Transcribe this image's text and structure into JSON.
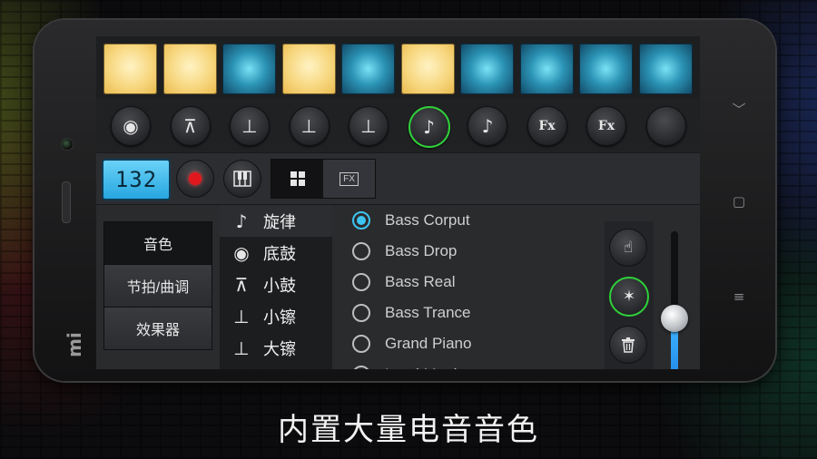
{
  "pads": [
    "on",
    "on",
    "off",
    "on",
    "off",
    "on",
    "off",
    "off",
    "off",
    "off"
  ],
  "instrument_buttons": [
    {
      "icon": "kick-drum-icon",
      "glyph": "◉",
      "active": false
    },
    {
      "icon": "snare-drum-icon",
      "glyph": "⊼",
      "active": false
    },
    {
      "icon": "hihat-icon",
      "glyph": "⊥",
      "active": false
    },
    {
      "icon": "crash-cymbal-icon",
      "glyph": "⊥",
      "active": false
    },
    {
      "icon": "ride-cymbal-icon",
      "glyph": "⊥",
      "active": false
    },
    {
      "icon": "music-note-icon",
      "glyph": "♪",
      "active": true
    },
    {
      "icon": "music-note-icon",
      "glyph": "♪",
      "active": false
    },
    {
      "icon": "fx-icon",
      "text": "Fx",
      "active": false
    },
    {
      "icon": "fx-icon",
      "text": "Fx",
      "active": false
    },
    {
      "icon": "empty-slot-icon",
      "glyph": "",
      "active": false
    }
  ],
  "controls": {
    "tempo": "132",
    "fx_tab_label": "FX"
  },
  "side_tabs": [
    "音色",
    "节拍/曲调",
    "效果器"
  ],
  "categories": [
    {
      "icon": "music-note-icon",
      "glyph": "♪",
      "label": "旋律"
    },
    {
      "icon": "kick-drum-icon",
      "glyph": "◉",
      "label": "底鼓"
    },
    {
      "icon": "snare-drum-icon",
      "glyph": "⊼",
      "label": "小鼓"
    },
    {
      "icon": "hihat-icon",
      "glyph": "⊥",
      "label": "小镲"
    },
    {
      "icon": "crash-cymbal-icon",
      "glyph": "⊥",
      "label": "大镲"
    }
  ],
  "sounds": [
    {
      "label": "Bass Corput",
      "selected": true
    },
    {
      "label": "Bass Drop",
      "selected": false
    },
    {
      "label": "Bass Real",
      "selected": false
    },
    {
      "label": "Bass Trance",
      "selected": false
    },
    {
      "label": "Grand Piano",
      "selected": false
    },
    {
      "label": "Lead Magic",
      "selected": false
    }
  ],
  "volume_level": 0.42,
  "caption": "内置大量电音音色",
  "colors": {
    "accent_blue": "#3ec4f2",
    "active_green": "#2fd13a",
    "pad_on": "#f7d77f",
    "pad_off": "#2b93b5",
    "record_red": "#e0181d"
  }
}
